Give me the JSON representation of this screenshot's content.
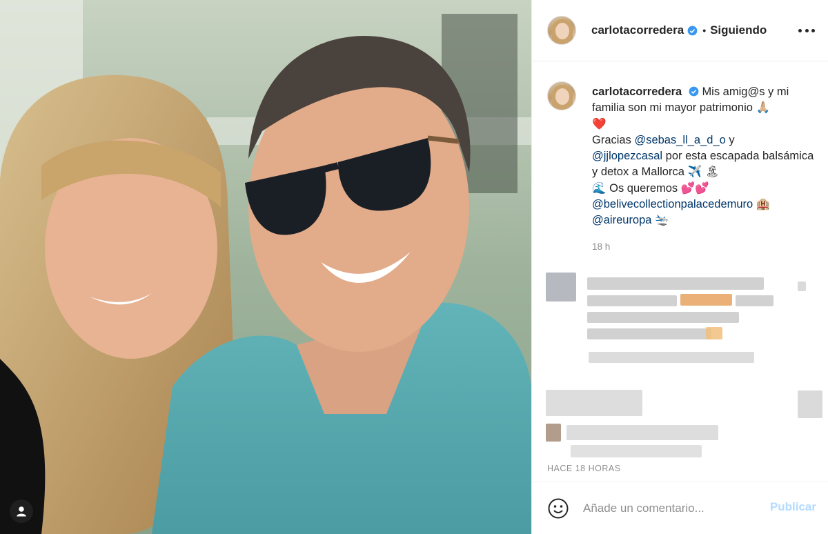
{
  "post": {
    "username": "carlotacorredera",
    "verified": true,
    "follow_status": "Siguiendo",
    "separator": "•"
  },
  "caption": {
    "username": "carlotacorredera",
    "line1": "Mis amig@s y mi familia son mi mayor patrimonio 🙏🏼",
    "line2": "❤️",
    "gracias": "Gracias",
    "mention1": "@sebas_ll_a_d_o",
    "y": "y",
    "mention2": "@jjlopezcasal",
    "line3": "por esta escapada balsámica y detox a Mallorca ✈️ 🏝",
    "line4": "🌊 Os queremos 💕💕",
    "mention3": "@belivecollectionpalacedemuro",
    "mention3_emoji": "🏨",
    "mention4": "@aireuropa",
    "mention4_emoji": "🛬",
    "time": "18 h"
  },
  "footer": {
    "ago": "HACE 18 HORAS",
    "comment_placeholder": "Añade un comentario...",
    "publish_label": "Publicar"
  },
  "colors": {
    "accent_link": "#00376b",
    "verified_blue": "#3897f0",
    "publish_disabled": "#b3dbff"
  },
  "icons": {
    "more": "more-options-icon",
    "verified": "verified-badge-icon",
    "emoji": "emoji-icon",
    "tag": "user-tag-icon"
  }
}
